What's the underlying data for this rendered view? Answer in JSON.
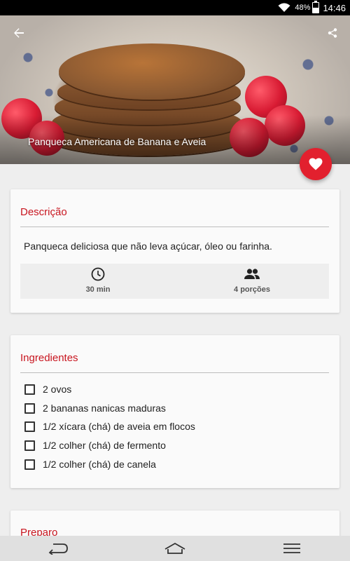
{
  "status_bar": {
    "battery_percent": "48%",
    "time": "14:46",
    "battery_level": 0.48
  },
  "hero": {
    "recipe_title": "Panqueca Americana de Banana e Aveia",
    "icons": {
      "back": "arrow-back-icon",
      "share": "share-icon"
    }
  },
  "favorite": {
    "icon": "heart-icon",
    "color": "#e2202e"
  },
  "description_card": {
    "title": "Descrição",
    "text": "Panqueca deliciosa que não leva açúcar, óleo ou farinha.",
    "time_label": "30 min",
    "servings_label": "4 porções",
    "icons": {
      "time": "clock-icon",
      "servings": "people-icon"
    }
  },
  "ingredients_card": {
    "title": "Ingredientes",
    "items": [
      {
        "label": "2 ovos",
        "checked": false
      },
      {
        "label": "2 bananas nanicas maduras",
        "checked": false
      },
      {
        "label": "1/2 xícara (chá) de aveia em flocos",
        "checked": false
      },
      {
        "label": "1/2 colher (chá) de fermento",
        "checked": false
      },
      {
        "label": "1/2 colher (chá) de canela",
        "checked": false
      }
    ]
  },
  "preparation_card": {
    "title": "Preparo"
  },
  "nav_bar": {
    "icons": [
      "back-nav-icon",
      "home-nav-icon",
      "menu-nav-icon"
    ]
  },
  "colors": {
    "accent": "#c8151f",
    "fab": "#e2202e",
    "background": "#eeeeee"
  }
}
